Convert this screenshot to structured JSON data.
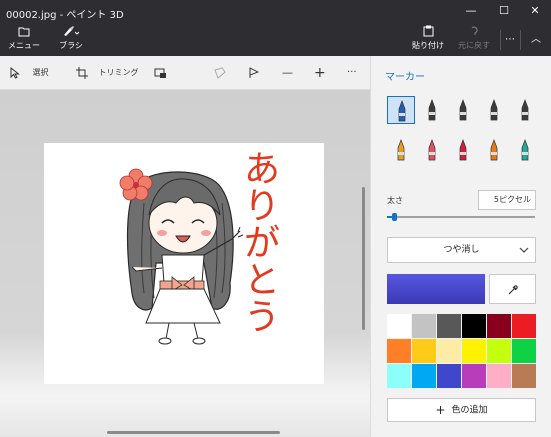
{
  "window": {
    "title": "00002.jpg - ペイント 3D",
    "minimize_glyph": "—",
    "maximize_glyph": "☐",
    "close_glyph": "✕"
  },
  "ribbon": {
    "menu_label": "メニュー",
    "brush_label": "ブラシ",
    "paste_label": "貼り付け",
    "redo_label": "元に戻す",
    "more_glyph": "⋯",
    "collapse_glyph": "︿"
  },
  "toolbar": {
    "select_label": "選択",
    "crop_label": "トリミング",
    "zoom_minus": "—",
    "zoom_plus": "+",
    "more": "···"
  },
  "canvas": {
    "greeting_text": "ありがとう"
  },
  "panel": {
    "title": "マーカー",
    "brushes": [
      {
        "icon": "marker-icon",
        "color": "#2a5db0"
      },
      {
        "icon": "calligraphy-pen-icon",
        "color": "#3c3c3c"
      },
      {
        "icon": "oil-brush-icon",
        "color": "#3c3c3c"
      },
      {
        "icon": "watercolor-icon",
        "color": "#3c3c3c"
      },
      {
        "icon": "pixel-pen-icon",
        "color": "#3c3c3c"
      },
      {
        "icon": "pencil-icon",
        "color": "#e0a020"
      },
      {
        "icon": "eraser-icon",
        "color": "#e05060"
      },
      {
        "icon": "crayon-icon",
        "color": "#d81b3a"
      },
      {
        "icon": "spray-can-icon",
        "color": "#e97a10"
      },
      {
        "icon": "fill-bucket-icon",
        "color": "#1faa9c"
      }
    ],
    "size_label": "太さ",
    "size_value": "5ピクセル",
    "size_fraction": 0.05,
    "finish_label": "つや消し",
    "current_color": "#3a3ab6",
    "palette": [
      "#ffffff",
      "#c3c3c3",
      "#585858",
      "#000000",
      "#88001b",
      "#ec1c24",
      "#ff7f27",
      "#ffca18",
      "#fdeca6",
      "#fff200",
      "#c4ff0e",
      "#0ed145",
      "#8cfffb",
      "#00a8f3",
      "#3f48cc",
      "#b83dba",
      "#ffaec8",
      "#b97a56"
    ],
    "add_color_label": "色の追加"
  },
  "colors": {
    "accent": "#1a6fc7",
    "titlebar": "#2d2d32",
    "greeting": "#e23a1e"
  }
}
